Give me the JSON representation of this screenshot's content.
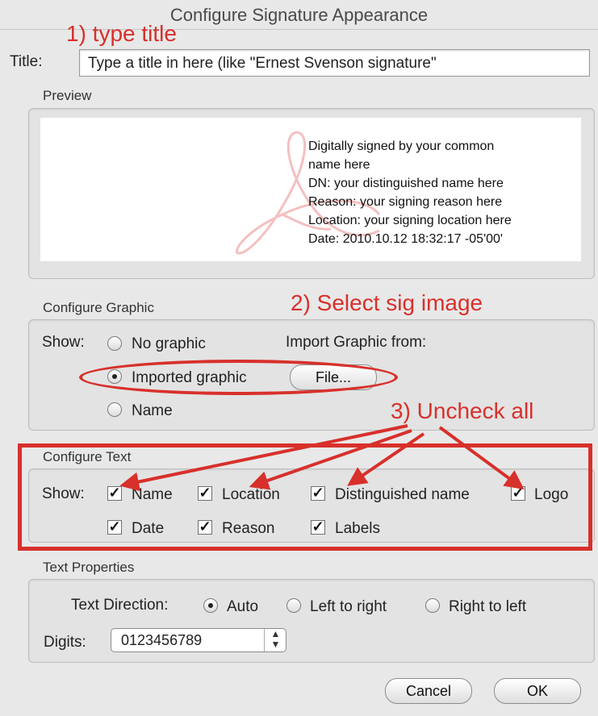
{
  "window": {
    "title": "Configure Signature Appearance"
  },
  "annotations": {
    "step1": "1) type title",
    "step2": "2) Select sig image",
    "step3": "3) Uncheck all"
  },
  "title_field": {
    "label": "Title:",
    "value": "Type a title in here (like \"Ernest Svenson signature\""
  },
  "preview": {
    "heading": "Preview",
    "lines": [
      "Digitally signed by your common",
      "name here",
      "DN: your distinguished name here",
      "Reason: your signing reason here",
      "Location: your signing location here",
      "Date: 2010.10.12 18:32:17 -05'00'"
    ]
  },
  "configure_graphic": {
    "heading": "Configure Graphic",
    "show_label": "Show:",
    "options": [
      "No graphic",
      "Imported graphic",
      "Name"
    ],
    "selected": "Imported graphic",
    "import_label": "Import Graphic from:",
    "file_button": "File..."
  },
  "configure_text": {
    "heading": "Configure Text",
    "show_label": "Show:",
    "items": [
      "Name",
      "Location",
      "Distinguished name",
      "Logo",
      "Date",
      "Reason",
      "Labels"
    ]
  },
  "text_properties": {
    "heading": "Text Properties",
    "direction_label": "Text Direction:",
    "options": [
      "Auto",
      "Left to right",
      "Right to left"
    ],
    "selected": "Auto",
    "digits_label": "Digits:",
    "digits_value": "0123456789"
  },
  "buttons": {
    "cancel": "Cancel",
    "ok": "OK"
  },
  "colors": {
    "annotation": "#d8302b",
    "background": "#e8e8e8"
  }
}
